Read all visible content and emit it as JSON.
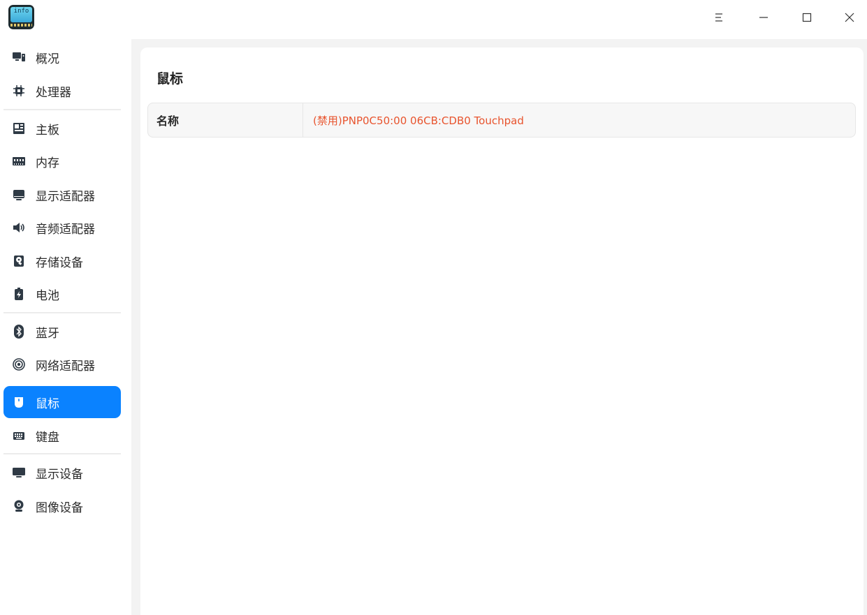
{
  "titlebar": {
    "app_icon_text": "info",
    "buttons": [
      "menu-icon",
      "minimize-icon",
      "maximize-icon",
      "close-icon"
    ]
  },
  "sidebar": {
    "items": [
      {
        "label": "概况",
        "icon": "overview-icon"
      },
      {
        "label": "处理器",
        "icon": "cpu-icon"
      },
      {
        "label": "主板",
        "icon": "motherboard-icon"
      },
      {
        "label": "内存",
        "icon": "memory-icon"
      },
      {
        "label": "显示适配器",
        "icon": "display-adapter-icon"
      },
      {
        "label": "音频适配器",
        "icon": "speaker-icon"
      },
      {
        "label": "存储设备",
        "icon": "storage-icon"
      },
      {
        "label": "电池",
        "icon": "battery-icon"
      },
      {
        "label": "蓝牙",
        "icon": "bluetooth-icon"
      },
      {
        "label": "网络适配器",
        "icon": "network-icon"
      },
      {
        "label": "鼠标",
        "icon": "mouse-icon",
        "active": true
      },
      {
        "label": "键盘",
        "icon": "keyboard-icon"
      },
      {
        "label": "显示设备",
        "icon": "monitor-icon"
      },
      {
        "label": "图像设备",
        "icon": "camera-icon"
      }
    ]
  },
  "main": {
    "title": "鼠标",
    "rows": [
      {
        "key": "名称",
        "value": "(禁用)PNP0C50:00 06CB:CDB0 Touchpad"
      }
    ]
  },
  "colors": {
    "accent": "#0a82ff",
    "disabled_value": "#e8542e",
    "icon": "#2f3a45"
  }
}
